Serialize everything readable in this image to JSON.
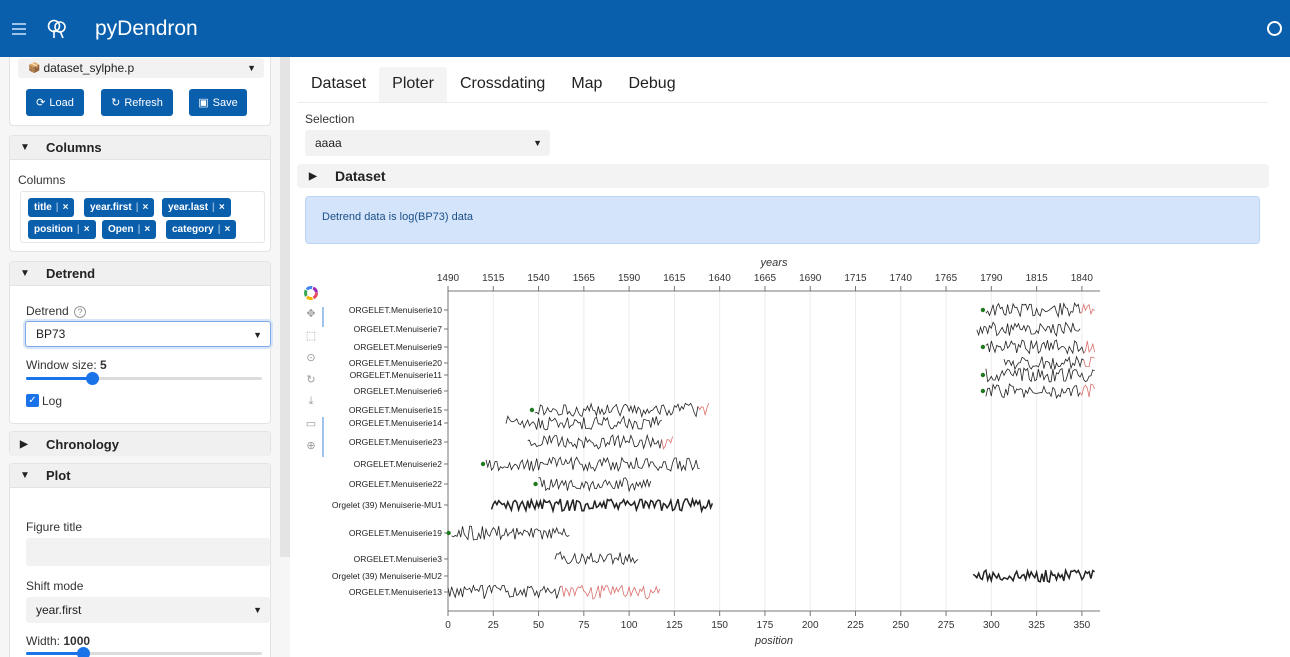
{
  "app": {
    "title": "pyDendron"
  },
  "sidebar": {
    "dataset_file": "dataset_sylphe.p",
    "buttons": {
      "load": "Load",
      "refresh": "Refresh",
      "save": "Save"
    },
    "columns_section": {
      "title": "Columns",
      "label": "Columns",
      "tags": [
        {
          "label": "title"
        },
        {
          "label": "year.first"
        },
        {
          "label": "year.last"
        },
        {
          "label": "position"
        },
        {
          "label": "Open"
        },
        {
          "label": "category"
        }
      ],
      "remove_glyph": "×"
    },
    "detrend_section": {
      "title": "Detrend",
      "label": "Detrend",
      "help_glyph": "?",
      "value": "BP73",
      "window_label": "Window size:",
      "window_value": "5",
      "window_fraction": 0.28,
      "log_label": "Log",
      "log_checked": true
    },
    "chronology_section": {
      "title": "Chronology"
    },
    "plot_section": {
      "title": "Plot",
      "figure_title_label": "Figure title",
      "figure_title_value": "",
      "shift_mode_label": "Shift mode",
      "shift_mode_value": "year.first",
      "width_label": "Width:",
      "width_value": "1000",
      "width_fraction": 0.24
    }
  },
  "main": {
    "tabs": [
      {
        "label": "Dataset",
        "active": false
      },
      {
        "label": "Ploter",
        "active": true
      },
      {
        "label": "Crossdating",
        "active": false
      },
      {
        "label": "Map",
        "active": false
      },
      {
        "label": "Debug",
        "active": false
      }
    ],
    "selection_label": "Selection",
    "selection_value": "aaaa",
    "dataset_expander": "Dataset",
    "info_message": "Detrend data is log(BP73) data"
  },
  "colors": {
    "primary": "#0a5fad",
    "accent": "#1a73e8",
    "info_bg": "#d3e4fb",
    "tail": "#d9706c",
    "dot": "#1f7a1f"
  },
  "icons": [
    "menu-icon",
    "trees-logo-icon",
    "status-ring-icon",
    "bokeh-logo-icon",
    "pan-icon",
    "box-zoom-icon",
    "wheel-zoom-icon",
    "reset-icon",
    "save-icon",
    "hover-icon",
    "crosshair-icon"
  ],
  "chart_data": {
    "type": "line",
    "xlabel": "position",
    "x2label": "years",
    "xlim": [
      0,
      360
    ],
    "x_ticks": [
      0,
      25,
      50,
      75,
      100,
      125,
      150,
      175,
      200,
      225,
      250,
      275,
      300,
      325,
      350
    ],
    "year_ticks": [
      1490,
      1515,
      1540,
      1565,
      1590,
      1615,
      1640,
      1665,
      1690,
      1715,
      1740,
      1765,
      1790,
      1815,
      1840
    ],
    "grid": true,
    "series": [
      {
        "name": "ORGELET.Menuiserie10",
        "start": 297,
        "end": 357,
        "dot": true,
        "tail": 8
      },
      {
        "name": "ORGELET.Menuiserie7",
        "start": 292,
        "end": 349,
        "dot": false,
        "tail": 0
      },
      {
        "name": "ORGELET.Menuiserie9",
        "start": 297,
        "end": 357,
        "dot": true,
        "tail": 6
      },
      {
        "name": "ORGELET.Menuiserie20",
        "start": 307,
        "end": 357,
        "dot": false,
        "tail": 6
      },
      {
        "name": "ORGELET.Menuiserie11",
        "start": 297,
        "end": 357,
        "dot": true,
        "tail": 0
      },
      {
        "name": "ORGELET.Menuiserie6",
        "start": 297,
        "end": 357,
        "dot": true,
        "tail": 8
      },
      {
        "name": "ORGELET.Menuiserie15",
        "start": 48,
        "end": 144,
        "dot": true,
        "tail": 6
      },
      {
        "name": "ORGELET.Menuiserie14",
        "start": 32,
        "end": 118,
        "dot": false,
        "tail": 0
      },
      {
        "name": "ORGELET.Menuiserie23",
        "start": 44,
        "end": 124,
        "dot": false,
        "tail": 6
      },
      {
        "name": "ORGELET.Menuiserie2",
        "start": 21,
        "end": 139,
        "dot": true,
        "tail": 0
      },
      {
        "name": "ORGELET.Menuiserie22",
        "start": 50,
        "end": 112,
        "dot": true,
        "tail": 0
      },
      {
        "name": "Orgelet (39) Menuiserie-MU1",
        "start": 24,
        "end": 146,
        "dot": false,
        "tail": 0,
        "bold": true
      },
      {
        "name": "ORGELET.Menuiserie19",
        "start": 2,
        "end": 67,
        "dot": true,
        "tail": 0
      },
      {
        "name": "ORGELET.Menuiserie3",
        "start": 59,
        "end": 105,
        "dot": false,
        "tail": 0
      },
      {
        "name": "Orgelet (39) Menuiserie-MU2",
        "start": 290,
        "end": 357,
        "dot": false,
        "tail": 0,
        "bold": true
      },
      {
        "name": "ORGELET.Menuiserie13",
        "start": 0,
        "end": 117,
        "dot": false,
        "tail": 55
      }
    ]
  }
}
